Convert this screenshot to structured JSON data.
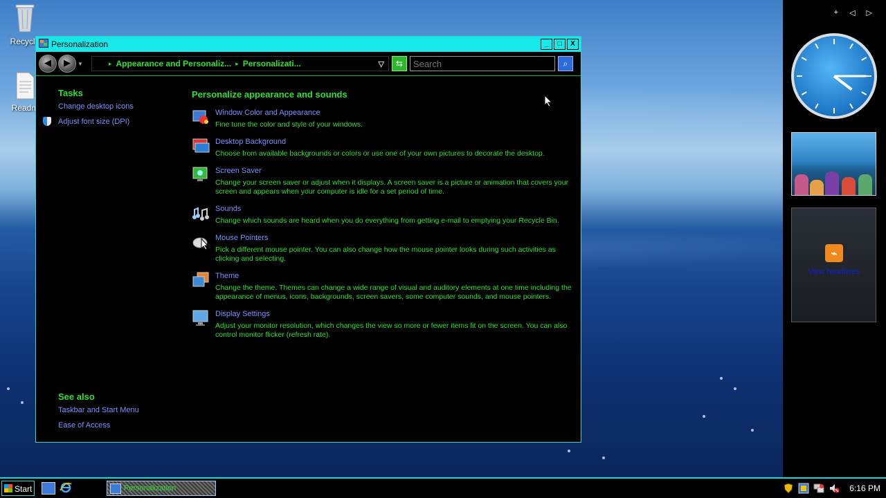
{
  "desktop": {
    "icons": [
      {
        "label": "Recycle",
        "icon": "recycle-bin-icon"
      },
      {
        "label": "Readm",
        "icon": "document-icon"
      }
    ]
  },
  "window": {
    "title": "Personalization",
    "controls": {
      "minimize": "_",
      "maximize": "□",
      "close": "X"
    },
    "address": {
      "segments": [
        "Appearance and Personaliz...",
        "Personalizati..."
      ]
    },
    "search": {
      "placeholder": "Search"
    },
    "sidebar": {
      "tasks_heading": "Tasks",
      "tasks": [
        "Change desktop icons",
        "Adjust font size (DPI)"
      ],
      "see_also_heading": "See also",
      "see_also": [
        "Taskbar and Start Menu",
        "Ease of Access"
      ]
    },
    "main": {
      "heading": "Personalize appearance and sounds",
      "items": [
        {
          "title": "Window Color and Appearance",
          "desc": "Fine tune the color and style of your windows.",
          "icon": "window-color-icon"
        },
        {
          "title": "Desktop Background",
          "desc": "Choose from available backgrounds or colors or use one of your own pictures to decorate the desktop.",
          "icon": "desktop-background-icon"
        },
        {
          "title": "Screen Saver",
          "desc": "Change your screen saver or adjust when it displays. A screen saver is a picture or animation that covers your screen and appears when your computer is idle for a set period of time.",
          "icon": "screen-saver-icon"
        },
        {
          "title": "Sounds",
          "desc": "Change which sounds are heard when you do everything from getting e-mail to emptying your Recycle Bin.",
          "icon": "sounds-icon"
        },
        {
          "title": "Mouse Pointers",
          "desc": "Pick a different mouse pointer. You can also change how the mouse pointer looks during such activities as clicking and selecting.",
          "icon": "mouse-pointer-icon"
        },
        {
          "title": "Theme",
          "desc": "Change the theme. Themes can change a wide range of visual and auditory elements at one time including the appearance of menus, icons, backgrounds, screen savers, some computer sounds, and mouse pointers.",
          "icon": "theme-icon"
        },
        {
          "title": "Display Settings",
          "desc": "Adjust your monitor resolution, which changes the view so more or fewer items fit on the screen. You can also control monitor flicker (refresh rate).",
          "icon": "display-settings-icon"
        }
      ]
    }
  },
  "gadgets": {
    "top_controls": [
      "+",
      "◁",
      "▷"
    ],
    "clock": {
      "hour": 4,
      "minute": 15
    },
    "feed": {
      "text": "View headlines"
    }
  },
  "taskbar": {
    "start_label": "Start",
    "task_button": "Personalization",
    "time": "6:16 PM"
  },
  "colors": {
    "accent_cyan": "#17e9ea",
    "text_green": "#2ee02e",
    "link_blue": "#7f8fff"
  }
}
